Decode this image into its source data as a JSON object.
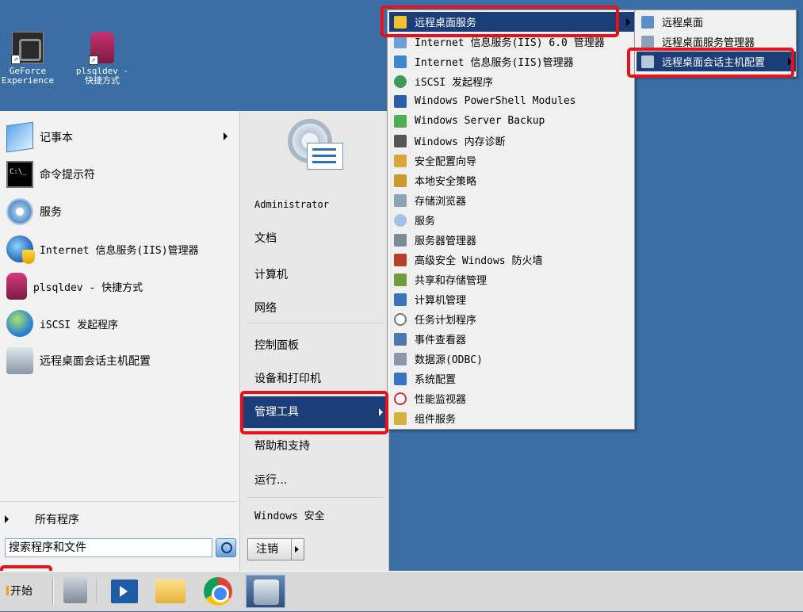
{
  "desktop": {
    "icons": [
      {
        "label_line1": "GeForce",
        "label_line2": "Experience",
        "icon": "geforce-icon"
      },
      {
        "label_line1": "plsqldev -",
        "label_line2": "快捷方式",
        "icon": "database-shortcut-icon"
      }
    ]
  },
  "start_menu": {
    "pinned_programs": [
      {
        "label": "记事本",
        "icon": "notepad-icon",
        "has_submenu": true
      },
      {
        "label": "命令提示符",
        "icon": "cmd-icon"
      },
      {
        "label": "服务",
        "icon": "services-gear-icon"
      },
      {
        "label": "Internet 信息服务(IIS)管理器",
        "icon": "iis-icon"
      },
      {
        "label": "plsqldev - 快捷方式",
        "icon": "database-icon"
      },
      {
        "label": "iSCSI 发起程序",
        "icon": "iscsi-globe-icon"
      },
      {
        "label": "远程桌面会话主机配置",
        "icon": "rd-session-host-icon"
      }
    ],
    "all_programs": "所有程序",
    "search_placeholder": "搜索程序和文件",
    "right_links": {
      "user": "Administrator",
      "documents": "文档",
      "computer": "计算机",
      "network": "网络",
      "control_panel": "控制面板",
      "devices_printers": "设备和打印机",
      "admin_tools": "管理工具",
      "help": "帮助和支持",
      "run": "运行...",
      "windows_security": "Windows 安全"
    },
    "logoff": "注销"
  },
  "admin_tools_menu": {
    "items": [
      {
        "label": "远程桌面服务",
        "icon": "folder-icon",
        "selected": true
      },
      {
        "label": "Internet 信息服务(IIS) 6.0 管理器",
        "icon": "iis6-icon"
      },
      {
        "label": "Internet 信息服务(IIS)管理器",
        "icon": "iis-manager-icon"
      },
      {
        "label": "iSCSI 发起程序",
        "icon": "iscsi-icon"
      },
      {
        "label": "Windows PowerShell Modules",
        "icon": "powershell-icon"
      },
      {
        "label": "Windows Server Backup",
        "icon": "backup-icon"
      },
      {
        "label": "Windows 内存诊断",
        "icon": "memory-diag-icon"
      },
      {
        "label": "安全配置向导",
        "icon": "security-wizard-icon"
      },
      {
        "label": "本地安全策略",
        "icon": "local-policy-icon"
      },
      {
        "label": "存储浏览器",
        "icon": "storage-explorer-icon"
      },
      {
        "label": "服务",
        "icon": "services-icon"
      },
      {
        "label": "服务器管理器",
        "icon": "server-manager-icon"
      },
      {
        "label": "高级安全 Windows 防火墙",
        "icon": "firewall-icon"
      },
      {
        "label": "共享和存储管理",
        "icon": "share-storage-icon"
      },
      {
        "label": "计算机管理",
        "icon": "computer-management-icon"
      },
      {
        "label": "任务计划程序",
        "icon": "task-scheduler-icon"
      },
      {
        "label": "事件查看器",
        "icon": "event-viewer-icon"
      },
      {
        "label": "数据源(ODBC)",
        "icon": "odbc-icon"
      },
      {
        "label": "系统配置",
        "icon": "system-config-icon"
      },
      {
        "label": "性能监视器",
        "icon": "perf-monitor-icon"
      },
      {
        "label": "组件服务",
        "icon": "component-services-icon"
      }
    ]
  },
  "rds_menu": {
    "items": [
      {
        "label": "远程桌面",
        "icon": "remote-desktop-icon"
      },
      {
        "label": "远程桌面服务管理器",
        "icon": "rds-manager-icon"
      },
      {
        "label": "远程桌面会话主机配置",
        "icon": "rd-session-host-config-icon",
        "selected": true
      }
    ]
  },
  "taskbar": {
    "start_label": "开始",
    "apps": [
      "server-manager-icon",
      "powershell-icon",
      "explorer-icon",
      "chrome-icon",
      "rd-config-icon"
    ]
  },
  "colors": {
    "desktop": "#3a6ea5",
    "selection": "#1b3d78",
    "highlight_box": "#e8111a"
  }
}
